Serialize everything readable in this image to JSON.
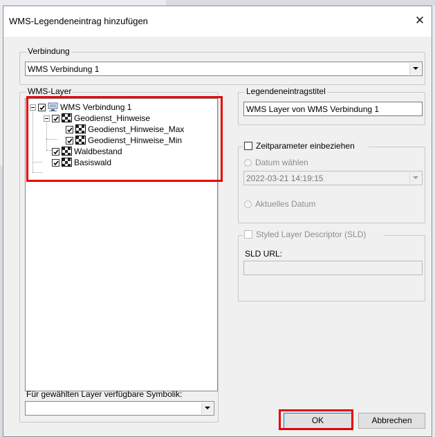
{
  "dialog": {
    "title": "WMS-Legendeneintrag hinzufügen"
  },
  "connection": {
    "group_label": "Verbindung",
    "selected": "WMS Verbindung 1"
  },
  "layers": {
    "group_label": "WMS-Layer",
    "tree": [
      {
        "label": "WMS Verbindung 1",
        "checked": true,
        "icon": "wms-server-icon"
      },
      {
        "label": "Geodienst_Hinweise",
        "checked": true,
        "icon": "layer-icon"
      },
      {
        "label": "Geodienst_Hinweise_Max",
        "checked": true,
        "icon": "layer-icon"
      },
      {
        "label": "Geodienst_Hinweise_Min",
        "checked": true,
        "icon": "layer-icon"
      },
      {
        "label": "Waldbestand",
        "checked": true,
        "icon": "layer-icon"
      },
      {
        "label": "Basiswald",
        "checked": true,
        "icon": "layer-icon"
      }
    ]
  },
  "symbology": {
    "label": "Für gewählten Layer verfügbare Symbolik:",
    "selected": ""
  },
  "legend_title": {
    "group_label": "Legendeneintragstitel",
    "value": "WMS Layer von WMS Verbindung 1"
  },
  "time": {
    "checkbox_label": "Zeitparameter einbeziehen",
    "checked": false,
    "choose_date_label": "Datum wählen",
    "date_value": "2022-03-21 14:19:15",
    "current_date_label": "Aktuelles Datum"
  },
  "sld": {
    "checkbox_label": "Styled Layer Descriptor (SLD)",
    "url_label": "SLD URL:",
    "url_value": ""
  },
  "buttons": {
    "ok": "OK",
    "cancel": "Abbrechen"
  },
  "colors": {
    "highlight": "#e60000",
    "dialog_bg": "#f0f0f0"
  }
}
